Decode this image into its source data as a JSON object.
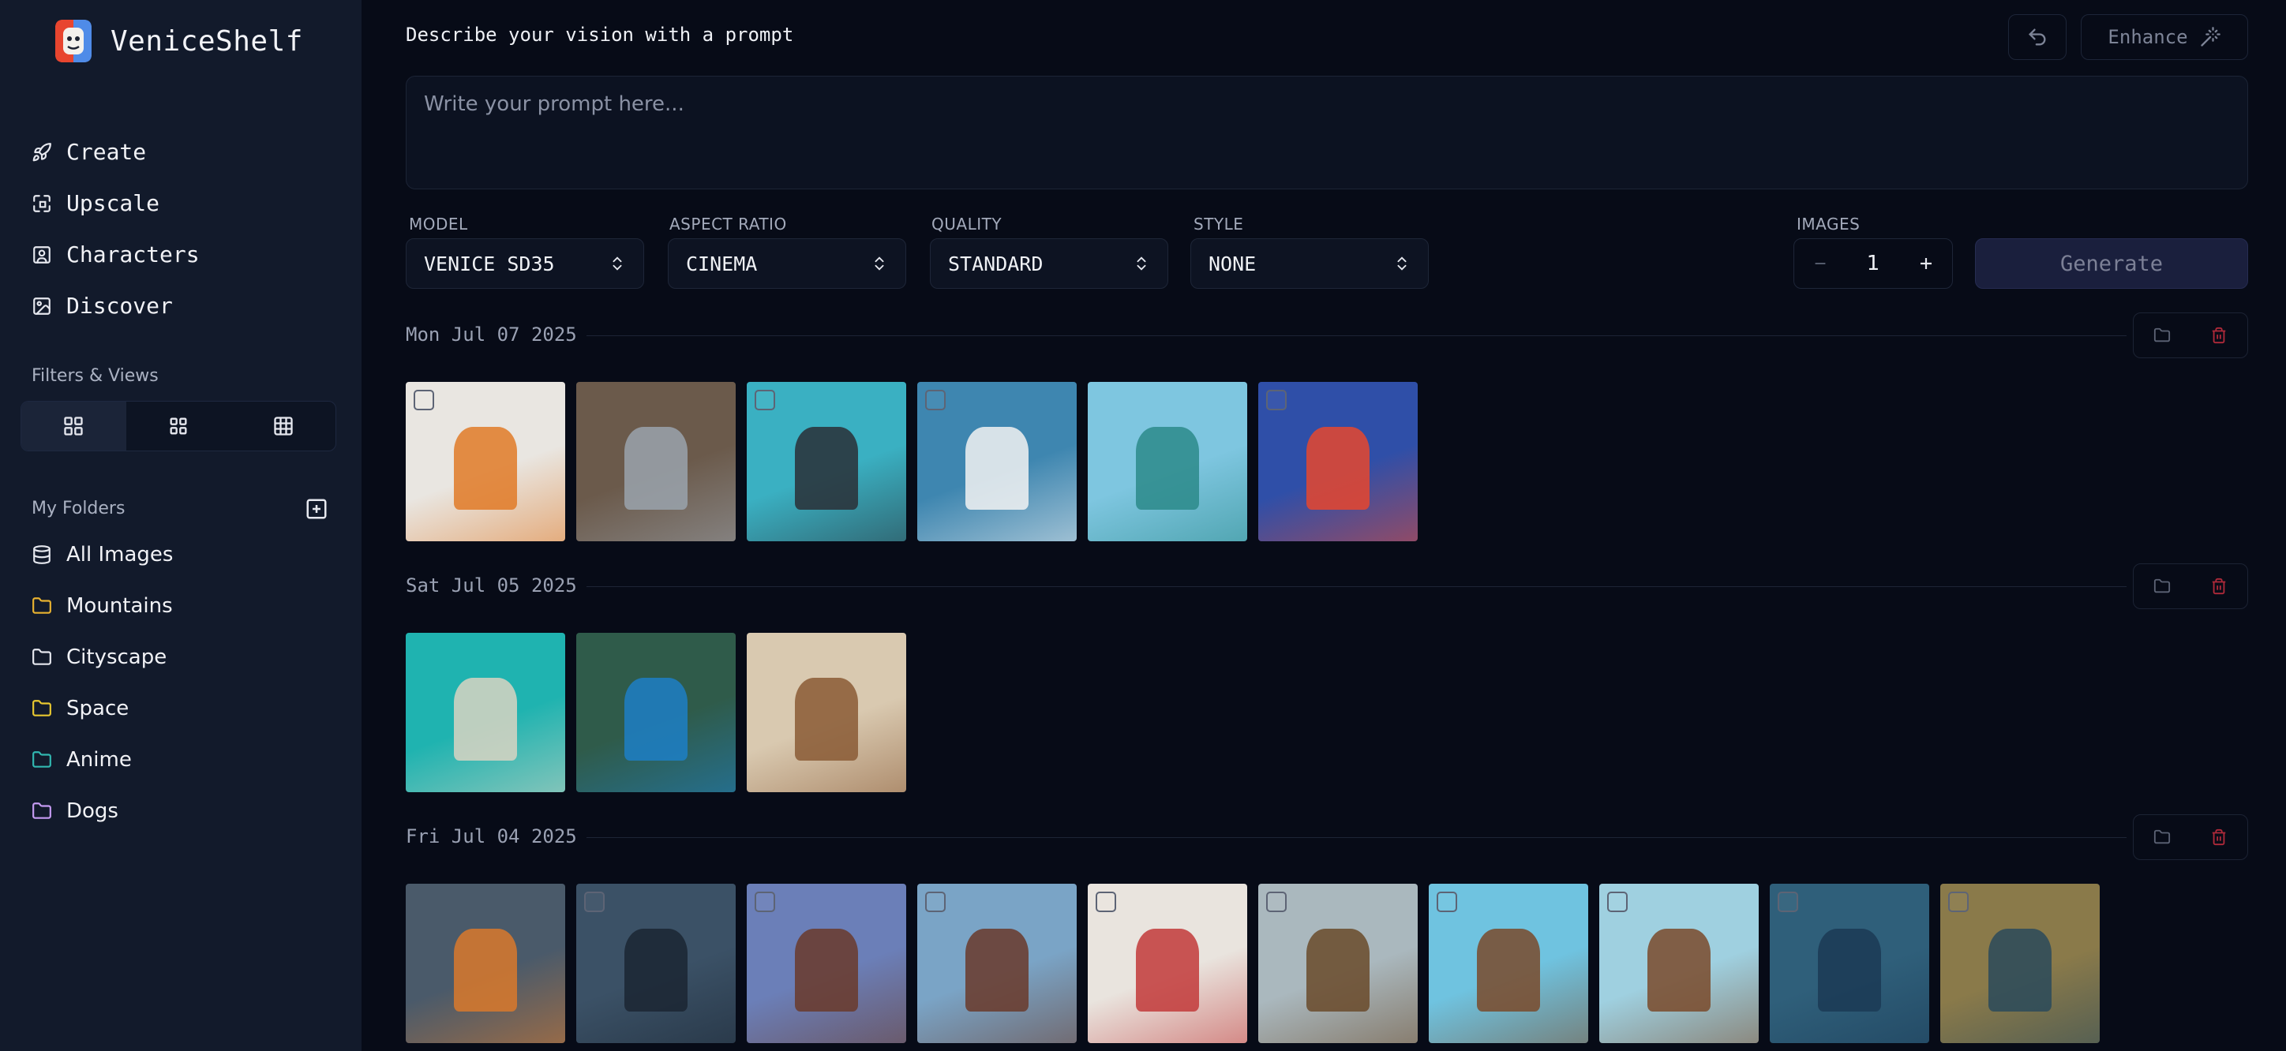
{
  "app": {
    "name": "VeniceShelf"
  },
  "nav": [
    {
      "label": "Create",
      "icon": "rocket-icon"
    },
    {
      "label": "Upscale",
      "icon": "upscale-icon"
    },
    {
      "label": "Characters",
      "icon": "person-icon"
    },
    {
      "label": "Discover",
      "icon": "image-icon"
    }
  ],
  "filters": {
    "label": "Filters & Views",
    "views": [
      "grid-large-icon",
      "grid-medium-icon",
      "grid-small-icon"
    ],
    "active": 0
  },
  "folders_section": {
    "label": "My Folders"
  },
  "folders": [
    {
      "label": "All Images",
      "icon": "database-icon",
      "color": "#e6e8ef"
    },
    {
      "label": "Mountains",
      "icon": "folder-icon",
      "color": "#e8b230"
    },
    {
      "label": "Cityscape",
      "icon": "folder-icon",
      "color": "#e6e8ef"
    },
    {
      "label": "Space",
      "icon": "folder-icon",
      "color": "#e8c830"
    },
    {
      "label": "Anime",
      "icon": "folder-icon",
      "color": "#31b7b0"
    },
    {
      "label": "Dogs",
      "icon": "folder-icon",
      "color": "#c59bf2"
    }
  ],
  "prompt": {
    "label": "Describe your vision with a prompt",
    "placeholder": "Write your prompt here...",
    "enhance_label": "Enhance"
  },
  "controls": {
    "model": {
      "label": "MODEL",
      "value": "VENICE SD35"
    },
    "aspect": {
      "label": "ASPECT RATIO",
      "value": "CINEMA"
    },
    "quality": {
      "label": "QUALITY",
      "value": "STANDARD"
    },
    "style": {
      "label": "STYLE",
      "value": "NONE"
    },
    "images": {
      "label": "IMAGES",
      "value": "1"
    },
    "generate_label": "Generate"
  },
  "groups": [
    {
      "date": "Mon Jul 07 2025",
      "images": [
        {
          "desc": "toy-box",
          "bg": "#e9e6e1",
          "accent": "#e07a27",
          "checkbox": true
        },
        {
          "desc": "figure-desk",
          "bg": "#6b5a4b",
          "accent": "#9aa3ad",
          "checkbox": false
        },
        {
          "desc": "blister-pack",
          "bg": "#3ab0c2",
          "accent": "#2a2f36",
          "checkbox": true
        },
        {
          "desc": "action-figure",
          "bg": "#3e86b0",
          "accent": "#f2f2f2",
          "checkbox": true
        },
        {
          "desc": "hammock-beach",
          "bg": "#7ec6e0",
          "accent": "#2b8a8a",
          "checkbox": false
        },
        {
          "desc": "mountain-sunset",
          "bg": "#2f4fa8",
          "accent": "#e6472e",
          "checkbox": true
        }
      ]
    },
    {
      "date": "Sat Jul 05 2025",
      "images": [
        {
          "desc": "isometric-houses",
          "bg": "#1fb3b0",
          "accent": "#d9d3c2",
          "checkbox": false
        },
        {
          "desc": "modern-villa",
          "bg": "#2f5b4a",
          "accent": "#1d7fc6",
          "checkbox": false
        },
        {
          "desc": "puppy-cake",
          "bg": "#d9c9b0",
          "accent": "#8a5a35",
          "checkbox": false
        }
      ]
    },
    {
      "date": "Fri Jul 04 2025",
      "images": [
        {
          "desc": "pirate-ship-storm",
          "bg": "#4a5a6a",
          "accent": "#d9792b",
          "checkbox": false
        },
        {
          "desc": "pirate-ship-dark",
          "bg": "#3b5166",
          "accent": "#1b2633",
          "checkbox": true
        },
        {
          "desc": "pirate-ship-sunset",
          "bg": "#6b7fb8",
          "accent": "#6a3a2a",
          "checkbox": true
        },
        {
          "desc": "pirate-ship-sea",
          "bg": "#7aa4c6",
          "accent": "#6a3a2a",
          "checkbox": true
        },
        {
          "desc": "paper-ship-red",
          "bg": "#e9e4de",
          "accent": "#c23a3a",
          "checkbox": true
        },
        {
          "desc": "paper-ship-white",
          "bg": "#aab8be",
          "accent": "#6a4a2a",
          "checkbox": true
        },
        {
          "desc": "cartoon-ship",
          "bg": "#6fc3e0",
          "accent": "#7a4a2a",
          "checkbox": true
        },
        {
          "desc": "cartoon-ship-2",
          "bg": "#9fd0e0",
          "accent": "#7a4a2a",
          "checkbox": true
        },
        {
          "desc": "blue-ship",
          "bg": "#2f5f7a",
          "accent": "#1b3a55",
          "checkbox": true
        },
        {
          "desc": "ship-golden-sky",
          "bg": "#8a7a4a",
          "accent": "#2a4a5a",
          "checkbox": true
        }
      ]
    }
  ]
}
